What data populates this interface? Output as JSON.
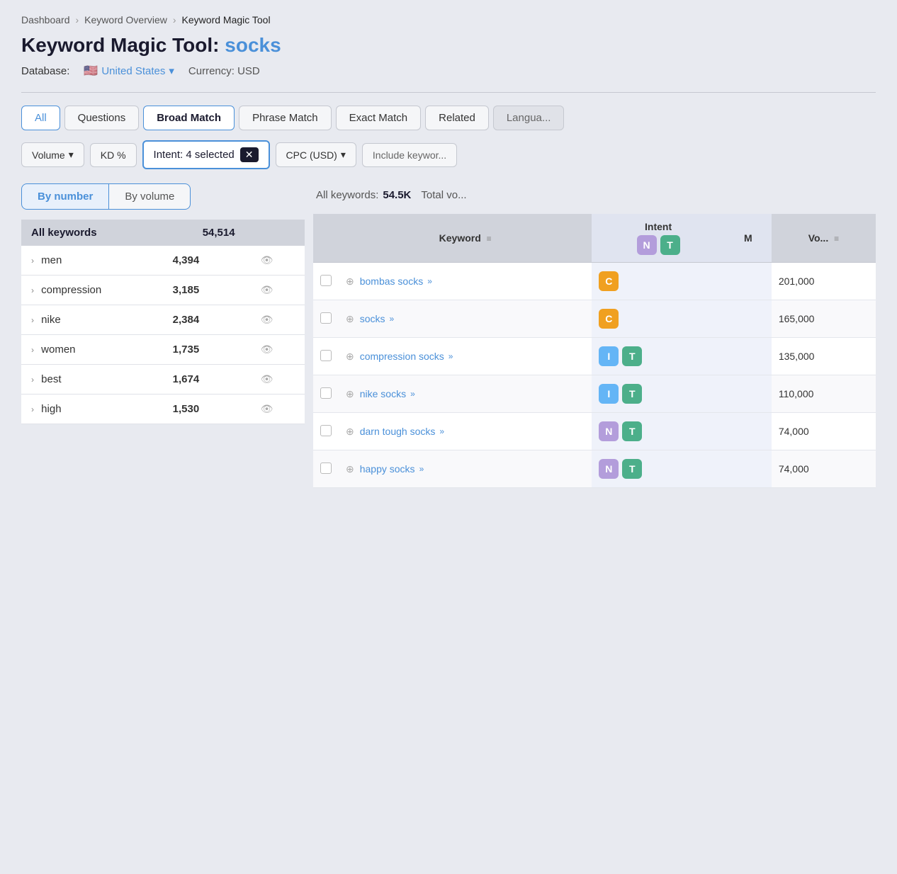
{
  "breadcrumb": {
    "items": [
      "Dashboard",
      "Keyword Overview",
      "Keyword Magic Tool"
    ]
  },
  "page": {
    "title_prefix": "Keyword Magic Tool: ",
    "title_keyword": "socks",
    "database_label": "Database:",
    "database_value": "United States",
    "currency_label": "Currency: USD"
  },
  "tabs": [
    {
      "id": "all",
      "label": "All",
      "state": "active"
    },
    {
      "id": "questions",
      "label": "Questions",
      "state": "normal"
    },
    {
      "id": "broad-match",
      "label": "Broad Match",
      "state": "selected"
    },
    {
      "id": "phrase-match",
      "label": "Phrase Match",
      "state": "normal"
    },
    {
      "id": "exact-match",
      "label": "Exact Match",
      "state": "normal"
    },
    {
      "id": "related",
      "label": "Related",
      "state": "normal"
    },
    {
      "id": "language",
      "label": "Langua...",
      "state": "lang"
    }
  ],
  "filters": {
    "volume_label": "Volume",
    "kd_label": "KD %",
    "intent_label": "Intent: 4 selected",
    "intent_x": "✕",
    "cpc_label": "CPC (USD)",
    "include_label": "Include keywor..."
  },
  "toggle": {
    "by_number": "By number",
    "by_volume": "By volume"
  },
  "sidebar": {
    "header_label": "All keywords",
    "header_count": "54,514",
    "rows": [
      {
        "group": "men",
        "count": "4,394"
      },
      {
        "group": "compression",
        "count": "3,185"
      },
      {
        "group": "nike",
        "count": "2,384"
      },
      {
        "group": "women",
        "count": "1,735"
      },
      {
        "group": "best",
        "count": "1,674"
      },
      {
        "group": "high",
        "count": "1,530"
      }
    ]
  },
  "table": {
    "all_keywords_label": "All keywords:",
    "all_keywords_count": "54.5K",
    "total_vol_label": "Total vo...",
    "intent_col_label": "Intent",
    "match_label": "M",
    "columns": [
      "",
      "Keyword",
      "Intent",
      "M",
      "Vo..."
    ],
    "rows": [
      {
        "keyword": "bombas socks",
        "badges": [
          "C"
        ],
        "badge_types": [
          "c"
        ],
        "volume": "201,000"
      },
      {
        "keyword": "socks",
        "badges": [
          "C"
        ],
        "badge_types": [
          "c"
        ],
        "volume": "165,000"
      },
      {
        "keyword": "compression socks",
        "badges": [
          "I",
          "T"
        ],
        "badge_types": [
          "i",
          "t"
        ],
        "volume": "135,000"
      },
      {
        "keyword": "nike socks",
        "badges": [
          "I",
          "T"
        ],
        "badge_types": [
          "i",
          "t"
        ],
        "volume": "110,000"
      },
      {
        "keyword": "darn tough socks",
        "badges": [
          "N",
          "T"
        ],
        "badge_types": [
          "n",
          "t"
        ],
        "volume": "74,000"
      },
      {
        "keyword": "happy socks",
        "badges": [
          "N",
          "T"
        ],
        "badge_types": [
          "n",
          "t"
        ],
        "volume": "74,000"
      }
    ]
  },
  "icons": {
    "chevron_down": "▾",
    "chevron_right": "›",
    "eye": "👁",
    "add_circle": "⊕",
    "double_arrow": "»",
    "sort": "≡",
    "x": "✕"
  }
}
